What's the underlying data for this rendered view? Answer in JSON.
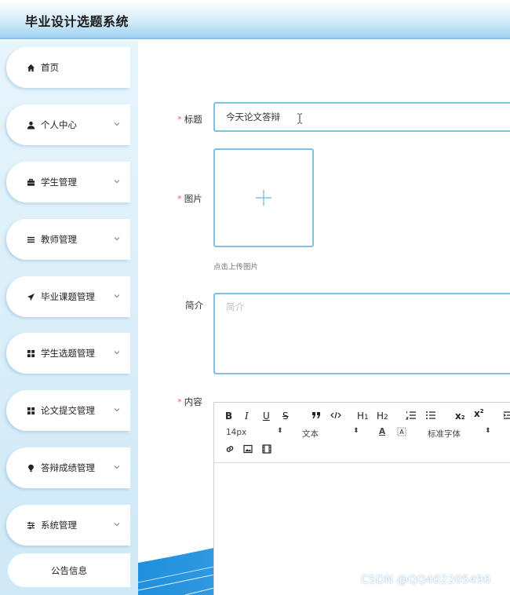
{
  "app": {
    "title": "毕业设计选题系统"
  },
  "sidebar": {
    "items": [
      {
        "label": "首页",
        "icon": "home-icon",
        "has_chevron": false
      },
      {
        "label": "个人中心",
        "icon": "user-icon",
        "has_chevron": true
      },
      {
        "label": "学生管理",
        "icon": "briefcase-icon",
        "has_chevron": true
      },
      {
        "label": "教师管理",
        "icon": "list-icon",
        "has_chevron": true
      },
      {
        "label": "毕业课题管理",
        "icon": "paper-plane-icon",
        "has_chevron": true
      },
      {
        "label": "学生选题管理",
        "icon": "grid-icon",
        "has_chevron": true
      },
      {
        "label": "论文提交管理",
        "icon": "grid-icon",
        "has_chevron": true
      },
      {
        "label": "答辩成绩管理",
        "icon": "bulb-icon",
        "has_chevron": true
      },
      {
        "label": "系统管理",
        "icon": "sliders-icon",
        "has_chevron": true
      }
    ],
    "notice_label": "公告信息"
  },
  "form": {
    "required_mark": "*",
    "title_label": "标题",
    "title_value": "今天论文答辩",
    "image_label": "图片",
    "upload_tip": "点击上传图片",
    "brief_label": "简介",
    "brief_placeholder": "简介",
    "content_label": "内容"
  },
  "editor": {
    "toolbar_row1": [
      "B",
      "I",
      "U",
      "S",
      "99",
      "</>",
      "H1",
      "H2",
      "ol",
      "ul",
      "x2-sub",
      "x2-sup",
      "indent"
    ],
    "font_size": "14px",
    "text_type": "文本",
    "font_family": "标准字体"
  },
  "watermark": "CSDN @QQ402205496",
  "colors": {
    "accent": "#7ec3dd",
    "required": "#f56c6c",
    "header_border": "#7ec6ee"
  }
}
